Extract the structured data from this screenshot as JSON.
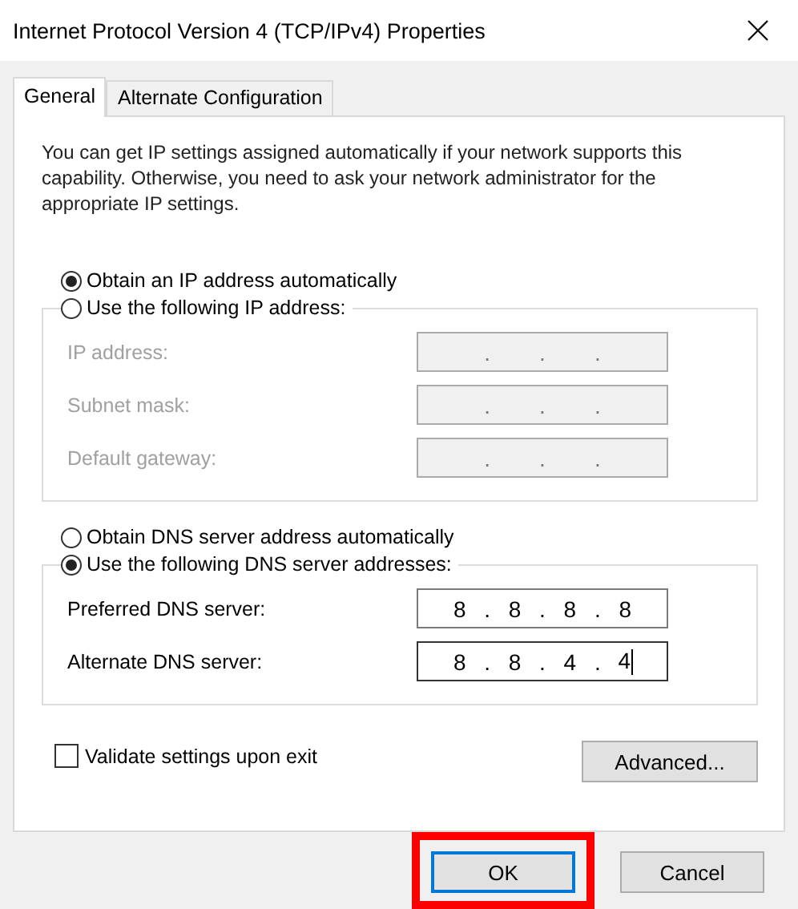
{
  "window": {
    "title": "Internet Protocol Version 4 (TCP/IPv4) Properties"
  },
  "tabs": [
    {
      "label": "General",
      "selected": true
    },
    {
      "label": "Alternate Configuration",
      "selected": false
    }
  ],
  "description": "You can get IP settings assigned automatically if your network supports this capability. Otherwise, you need to ask your network administrator for the appropriate IP settings.",
  "separator": ".",
  "ip_section": {
    "auto_option": {
      "label": "Obtain an IP address automatically",
      "selected": true
    },
    "manual_option": {
      "label": "Use the following IP address:",
      "selected": false
    },
    "fields": [
      {
        "label": "IP address:",
        "disabled": true,
        "focused": false
      },
      {
        "label": "Subnet mask:",
        "disabled": true,
        "focused": false
      },
      {
        "label": "Default gateway:",
        "disabled": true,
        "focused": false
      }
    ]
  },
  "dns_section": {
    "auto_option": {
      "label": "Obtain DNS server address automatically",
      "selected": false
    },
    "manual_option": {
      "label": "Use the following DNS server addresses:",
      "selected": true
    },
    "fields": [
      {
        "label": "Preferred DNS server:",
        "octets": [
          "8",
          "8",
          "8",
          "8"
        ],
        "disabled": false,
        "focused": false
      },
      {
        "label": "Alternate DNS server:",
        "octets": [
          "8",
          "8",
          "4",
          "4"
        ],
        "disabled": false,
        "focused": true
      }
    ]
  },
  "validate_checkbox": {
    "label": "Validate settings upon exit",
    "checked": false
  },
  "advanced_button": "Advanced...",
  "buttons": [
    {
      "label": "OK",
      "default": true,
      "highlighted": true
    },
    {
      "label": "Cancel",
      "default": false,
      "highlighted": false
    }
  ]
}
